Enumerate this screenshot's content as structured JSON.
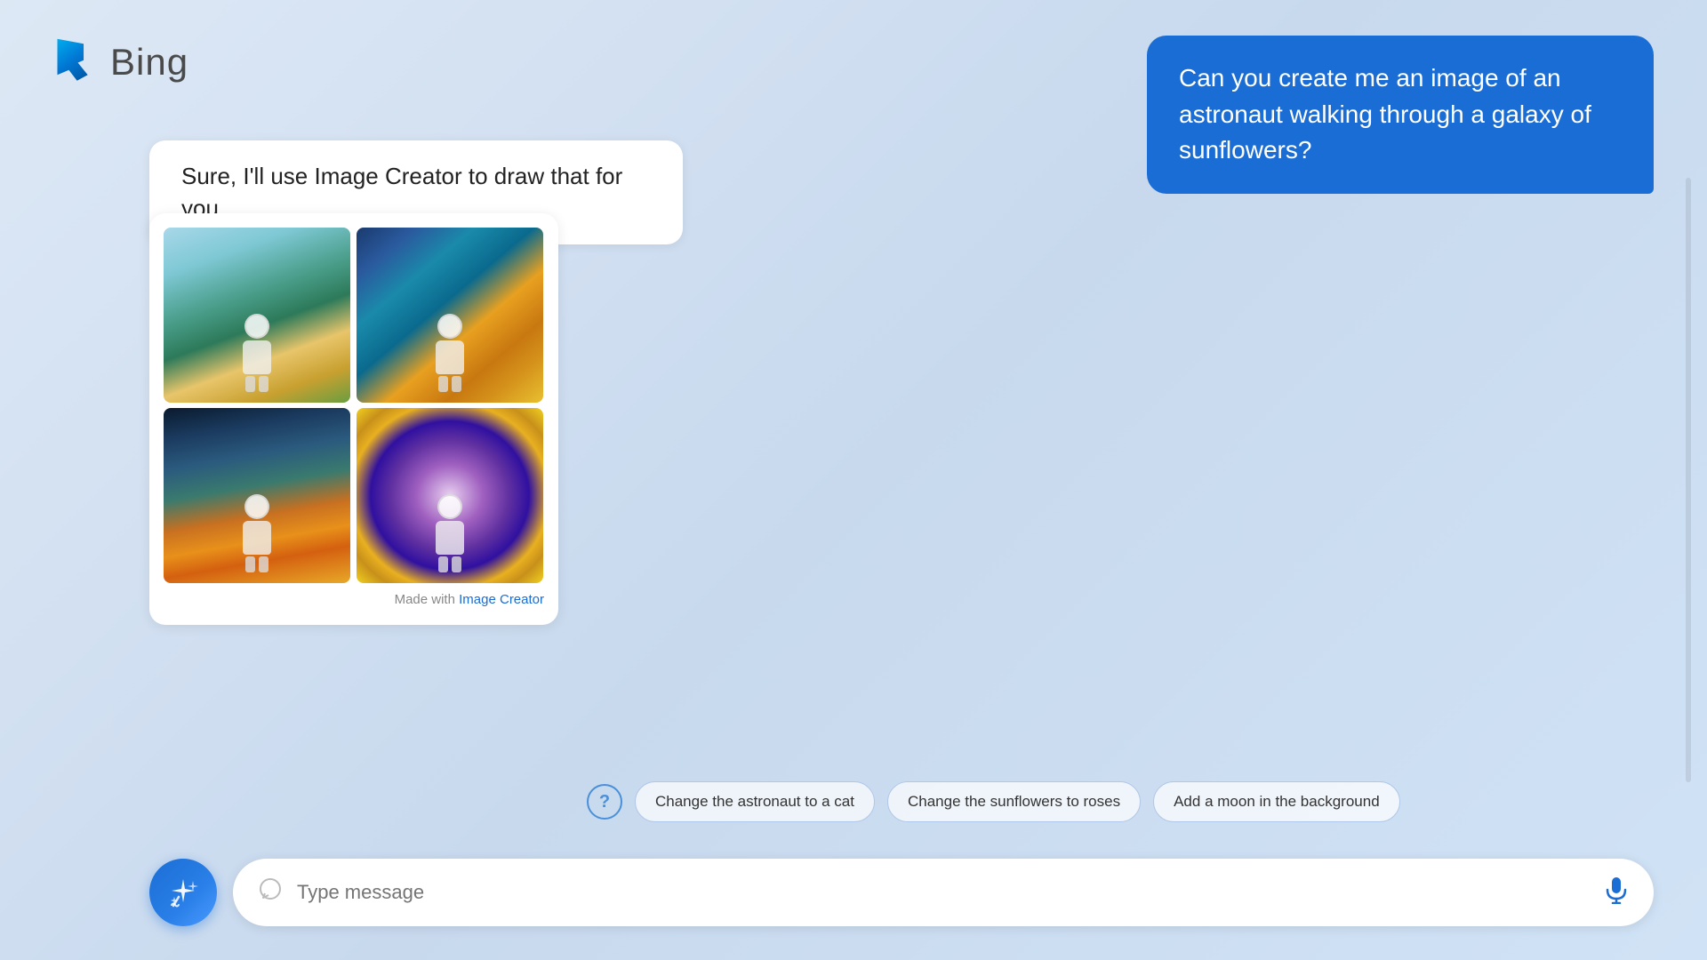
{
  "logo": {
    "icon_name": "bing-logo-icon",
    "label": "Bing"
  },
  "user_message": {
    "text": "Can you create me an image of an astronaut walking through a galaxy of sunflowers?"
  },
  "bot_reply": {
    "text": "Sure, I'll use Image Creator to draw that for you."
  },
  "image_grid": {
    "made_with_text": "Made with ",
    "made_with_link": "Image Creator"
  },
  "suggestions": {
    "help_label": "?",
    "chips": [
      {
        "label": "Change the astronaut to a cat"
      },
      {
        "label": "Change the sunflowers to roses"
      },
      {
        "label": "Add a moon in the background"
      }
    ]
  },
  "input_bar": {
    "magic_button_label": "Magic",
    "placeholder": "Type message",
    "mic_label": "Microphone"
  }
}
